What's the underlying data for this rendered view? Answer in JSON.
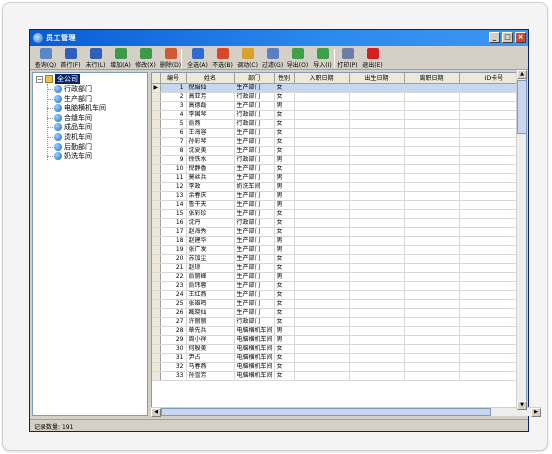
{
  "window": {
    "title": "员工管理"
  },
  "toolbar": {
    "buttons": [
      {
        "label": "查询(Q)",
        "color": "#5b86c9"
      },
      {
        "label": "首行(F)",
        "color": "#2f5fb8"
      },
      {
        "label": "末行(L)",
        "color": "#2f5fb8"
      },
      {
        "label": "增加(A)",
        "color": "#3c9a4a"
      },
      {
        "label": "修改(X)",
        "color": "#3c9a4a"
      },
      {
        "label": "删除(D)",
        "color": "#d05a33"
      },
      {
        "label": "全选(A)",
        "color": "#2f6bd0"
      },
      {
        "label": "不选(B)",
        "color": "#d9472b"
      },
      {
        "label": "调动(C)",
        "color": "#d6a22c"
      },
      {
        "label": "过滤(G)",
        "color": "#5a80c4"
      },
      {
        "label": "导出(O)",
        "color": "#3ea04a"
      },
      {
        "label": "导入(I)",
        "color": "#3ea04a"
      },
      {
        "label": "打印(P)",
        "color": "#6c7ea6"
      },
      {
        "label": "退出(E)",
        "color": "#d32020"
      }
    ]
  },
  "tree": {
    "root": "全公司",
    "items": [
      "行政部门",
      "生产部门",
      "电脑横机车间",
      "合缝车间",
      "成品车间",
      "烫机车间",
      "后勤部门",
      "奶洗车间"
    ]
  },
  "grid": {
    "columns": [
      "编号",
      "姓名",
      "部门",
      "性别",
      "入职日期",
      "出生日期",
      "离职日期",
      "ID卡号",
      "职"
    ],
    "rows": [
      [
        "1",
        "倪娟仙",
        "生产部门",
        "女"
      ],
      [
        "2",
        "高亚芳",
        "行政部门",
        "女"
      ],
      [
        "3",
        "高德磊",
        "生产部门",
        "男"
      ],
      [
        "4",
        "李国琴",
        "行政部门",
        "女"
      ],
      [
        "5",
        "俞燕",
        "行政部门",
        "女"
      ],
      [
        "6",
        "王海容",
        "生产部门",
        "女"
      ],
      [
        "7",
        "孙彩琴",
        "生产部门",
        "女"
      ],
      [
        "8",
        "沈夏美",
        "生产部门",
        "女"
      ],
      [
        "9",
        "徐铁水",
        "行政部门",
        "男"
      ],
      [
        "10",
        "倪静香",
        "生产部门",
        "女"
      ],
      [
        "11",
        "莫丝兵",
        "生产部门",
        "男"
      ],
      [
        "12",
        "李政",
        "奶洗车间",
        "男"
      ],
      [
        "13",
        "余春庆",
        "生产部门",
        "男"
      ],
      [
        "14",
        "鲁干天",
        "生产部门",
        "男"
      ],
      [
        "15",
        "张彩珍",
        "生产部门",
        "女"
      ],
      [
        "16",
        "沈丹",
        "行政部门",
        "女"
      ],
      [
        "17",
        "赵海秀",
        "生产部门",
        "女"
      ],
      [
        "18",
        "赵建华",
        "生产部门",
        "男"
      ],
      [
        "19",
        "张广发",
        "生产部门",
        "男"
      ],
      [
        "20",
        "苏加尘",
        "生产部门",
        "女"
      ],
      [
        "21",
        "赵琼",
        "生产部门",
        "女"
      ],
      [
        "22",
        "俞丽峰",
        "生产部门",
        "男"
      ],
      [
        "23",
        "俞玮蓉",
        "生产部门",
        "女"
      ],
      [
        "24",
        "王红燕",
        "生产部门",
        "女"
      ],
      [
        "25",
        "张雄鸣",
        "生产部门",
        "女"
      ],
      [
        "26",
        "臧晓仙",
        "生产部门",
        "女"
      ],
      [
        "27",
        "许丽丽",
        "行政部门",
        "女"
      ],
      [
        "28",
        "章先兵",
        "电脑横机车间",
        "男"
      ],
      [
        "29",
        "周小祥",
        "电脑横机车间",
        "男"
      ],
      [
        "30",
        "何殷美",
        "电脑横机车间",
        "女"
      ],
      [
        "31",
        "尹占",
        "电脑横机车间",
        "女"
      ],
      [
        "32",
        "马春燕",
        "电脑横机车间",
        "女"
      ],
      [
        "33",
        "孙雪芳",
        "电脑横机车间",
        "女"
      ]
    ]
  },
  "status": {
    "label": "记录数量:",
    "count": "191"
  }
}
